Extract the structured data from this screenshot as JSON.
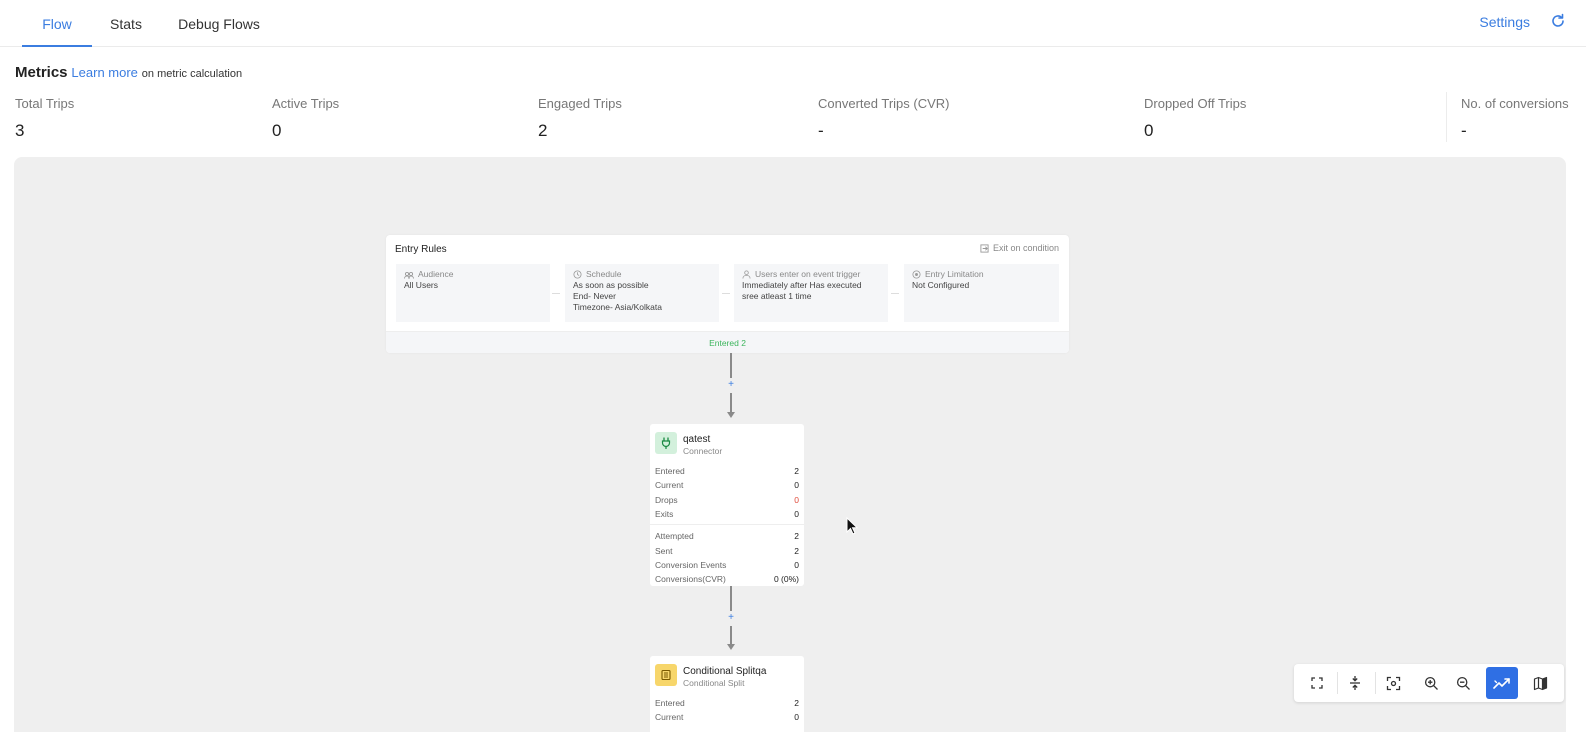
{
  "tabs": {
    "flow": "Flow",
    "stats": "Stats",
    "debug": "Debug Flows"
  },
  "header": {
    "settings": "Settings"
  },
  "metrics": {
    "title": "Metrics",
    "learn_more": "Learn more",
    "suffix": "on metric calculation",
    "items": [
      {
        "label": "Total Trips",
        "value": "3"
      },
      {
        "label": "Active Trips",
        "value": "0"
      },
      {
        "label": "Engaged Trips",
        "value": "2"
      },
      {
        "label": "Converted Trips (CVR)",
        "value": "-"
      },
      {
        "label": "Dropped Off Trips",
        "value": "0"
      },
      {
        "label": "No. of conversions",
        "value": "-"
      }
    ]
  },
  "entry": {
    "title": "Entry Rules",
    "exit_condition": "Exit on condition",
    "audience": {
      "heading": "Audience",
      "line1": "All Users"
    },
    "schedule": {
      "heading": "Schedule",
      "line1": "As soon as possible",
      "line2": "End- Never",
      "line3": "Timezone- Asia/Kolkata"
    },
    "trigger": {
      "heading": "Users enter on event trigger",
      "line1": "Immediately after Has executed",
      "line2": "sree atleast 1 time"
    },
    "limitation": {
      "heading": "Entry Limitation",
      "line1": "Not Configured"
    },
    "entered": "Entered 2"
  },
  "connector_symbol": "+",
  "node1": {
    "title": "qatest",
    "subtitle": "Connector",
    "rows": [
      {
        "label": "Entered",
        "value": "2"
      },
      {
        "label": "Current",
        "value": "0"
      },
      {
        "label": "Drops",
        "value": "0"
      },
      {
        "label": "Exits",
        "value": "0"
      }
    ],
    "rows2": [
      {
        "label": "Attempted",
        "value": "2"
      },
      {
        "label": "Sent",
        "value": "2"
      },
      {
        "label": "Conversion Events",
        "value": "0"
      },
      {
        "label": "Conversions(CVR)",
        "value": "0 (0%)"
      }
    ]
  },
  "node2": {
    "title": "Conditional Splitqa",
    "subtitle": "Conditional Split",
    "rows": [
      {
        "label": "Entered",
        "value": "2"
      },
      {
        "label": "Current",
        "value": "0"
      }
    ]
  },
  "colors": {
    "accent": "#3b7de0",
    "success": "#3cb55c",
    "danger": "#e04b3b",
    "canvas": "#efefef"
  },
  "icons": {
    "refresh": "refresh-icon",
    "node1": "plug-icon",
    "node2": "split-icon"
  }
}
